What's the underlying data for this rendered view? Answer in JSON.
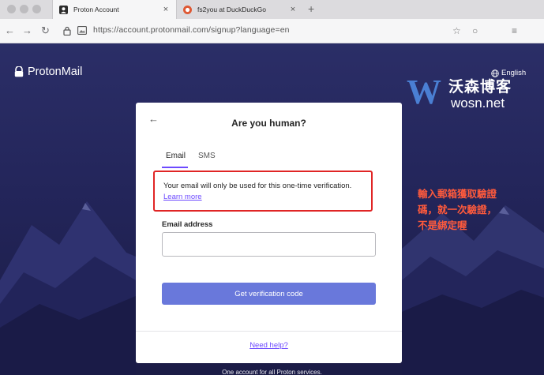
{
  "browser": {
    "tabs": [
      {
        "title": "Proton Account",
        "close": "×"
      },
      {
        "title": "fs2you at DuckDuckGo",
        "close": "×"
      }
    ],
    "new_tab": "+",
    "url": "https://account.protonmail.com/signup?language=en"
  },
  "brand": {
    "name": "ProtonMail"
  },
  "language": {
    "label": "English"
  },
  "watermark": {
    "mark": "W",
    "text_cn": "沃森博客",
    "text_en": "wosn.net"
  },
  "card": {
    "back_glyph": "←",
    "title": "Are you human?",
    "tabs": [
      {
        "label": "Email"
      },
      {
        "label": "SMS"
      }
    ],
    "notice": "Your email will only be used for this one-time verification.",
    "learn_more": "Learn more",
    "field_label": "Email address",
    "email_value": "",
    "submit": "Get verification code",
    "help": "Need help?"
  },
  "footer": {
    "text": "One account for all Proton services."
  },
  "annotation": {
    "text": "輸入郵箱獲取驗證碼，就一次驗證，不是綁定喔"
  },
  "colors": {
    "accent": "#6d4aff",
    "button": "#6978db",
    "highlight_border": "#e02525",
    "annotation": "#ff5a3c",
    "background": "#25285e"
  }
}
